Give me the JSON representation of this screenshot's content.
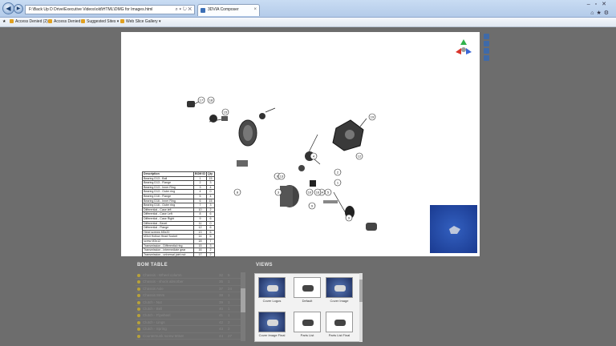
{
  "browser": {
    "address": "F:\\Back Up D Drive\\Executive Videos\\old\\HTML\\DMG for Images.html",
    "address_tools": "⌕ ▾ ↻ ✕",
    "tab_title": "3DVIA Composer",
    "favorites": [
      {
        "label": "Access Denied (2)"
      },
      {
        "label": "Access Denied"
      },
      {
        "label": "Suggested Sites ▾"
      },
      {
        "label": "Web Slice Gallery ▾"
      }
    ]
  },
  "bom_table": {
    "headers": {
      "description": "Description",
      "bom_id": "BOM ID",
      "qty": "Qty"
    },
    "rows": [
      {
        "d": "Bearing D13 - Ball",
        "id": "1",
        "q": "15"
      },
      {
        "d": "Bearing D13 - Flange",
        "id": "2",
        "q": "3"
      },
      {
        "d": "Bearing D13 - Inner Ring",
        "id": "3",
        "q": "4"
      },
      {
        "d": "Bearing D13 - Outer ring",
        "id": "4",
        "q": "0"
      },
      {
        "d": "Bearing D16 - Flange",
        "id": "5",
        "q": "4"
      },
      {
        "d": "Bearing D16 - Inner Ring",
        "id": "6",
        "q": "15"
      },
      {
        "d": "Bearing D16 - Outer ring",
        "id": "7",
        "q": "3"
      },
      {
        "d": "Differential - Case left",
        "id": "10",
        "q": "2"
      },
      {
        "d": "Differential - Case Left",
        "id": "8",
        "q": "6"
      },
      {
        "d": "Differential - Case Right",
        "id": "9",
        "q": "6"
      },
      {
        "d": "Differential - Bevel",
        "id": "11",
        "q": "0"
      },
      {
        "d": "Differential - Flange",
        "id": "12",
        "q": "6"
      },
      {
        "d": "Hexd screws M3x20",
        "id": "13",
        "q": "6"
      },
      {
        "d": "M3x4 Hollow Head Socket",
        "id": "14",
        "q": "6"
      },
      {
        "d": "screw M3x12",
        "id": "18",
        "q": "7"
      },
      {
        "d": "Transmission - Differential ring",
        "id": "15",
        "q": "3"
      },
      {
        "d": "Transmission - intermediate gear",
        "id": "16",
        "q": "2"
      },
      {
        "d": "Transmission - universal joint nut",
        "id": "17",
        "q": "2"
      }
    ]
  },
  "bom_panel": {
    "title": "BOM TABLE",
    "rows": [
      {
        "label": "Chassis - Wheel column",
        "c1": "32",
        "c2": "5"
      },
      {
        "label": "Chassis - shock absorber",
        "c1": "35",
        "c2": "1"
      },
      {
        "label": "Chassis Axle",
        "c1": "37",
        "c2": "24"
      },
      {
        "label": "Chassis 8mm",
        "c1": "38",
        "c2": "1"
      },
      {
        "label": "Clutch - Nut",
        "c1": "39",
        "c2": "1"
      },
      {
        "label": "Clutch - Bell",
        "c1": "40",
        "c2": "1"
      },
      {
        "label": "Clutch - Flywheel",
        "c1": "41",
        "c2": "1"
      },
      {
        "label": "Clutch - Lings",
        "c1": "42",
        "c2": "2"
      },
      {
        "label": "Clutch - Spring",
        "c1": "43",
        "c2": "2"
      },
      {
        "label": "Countersunk screw M3x8",
        "c1": "44",
        "c2": "27"
      },
      {
        "label": "Drive adapter",
        "c1": "45",
        "c2": "1"
      },
      {
        "label": "D2A Bearing Cap Nuts",
        "c1": "46",
        "c2": "1"
      }
    ]
  },
  "views_panel": {
    "title": "VIEWS",
    "items": [
      {
        "label": "Cover Logos",
        "style": "dark"
      },
      {
        "label": "Default",
        "style": "light"
      },
      {
        "label": "Cover Image",
        "style": "dark"
      },
      {
        "label": "Cover Image Final",
        "style": "dark"
      },
      {
        "label": "Parts List",
        "style": "light"
      },
      {
        "label": "Parts List Final",
        "style": "light"
      }
    ]
  },
  "callouts": [
    "19",
    "17",
    "18",
    "15",
    "12",
    "8",
    "6",
    "2",
    "5",
    "1",
    "14",
    "4",
    "3",
    "13",
    "10",
    "16",
    "9",
    "9",
    "7"
  ]
}
